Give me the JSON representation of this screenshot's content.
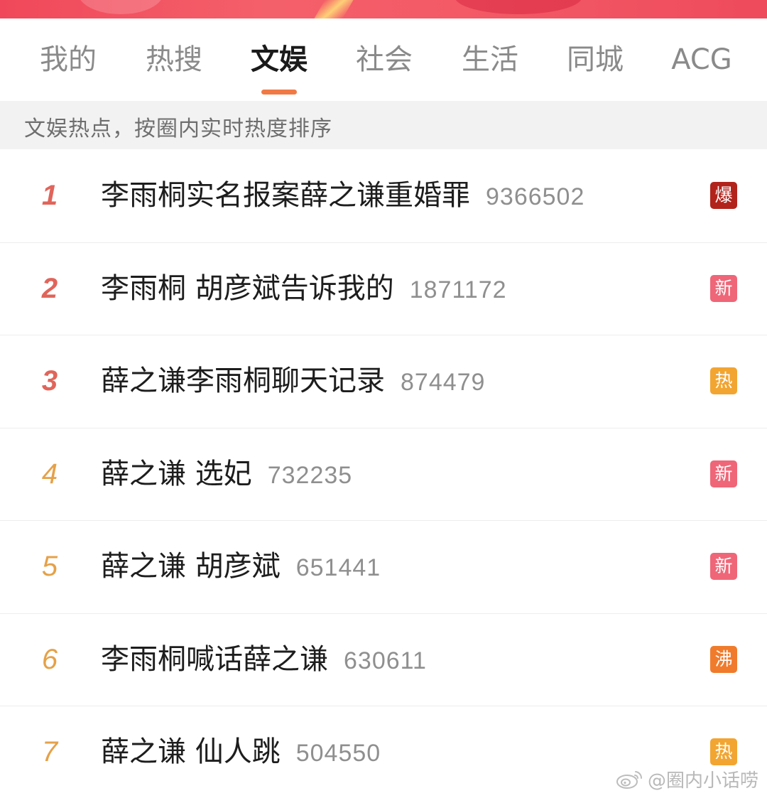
{
  "tabs": [
    {
      "label": "我的",
      "active": false
    },
    {
      "label": "热搜",
      "active": false
    },
    {
      "label": "文娱",
      "active": true
    },
    {
      "label": "社会",
      "active": false
    },
    {
      "label": "生活",
      "active": false
    },
    {
      "label": "同城",
      "active": false
    },
    {
      "label": "ACG",
      "active": false
    }
  ],
  "subheader": {
    "text": "文娱热点，按圈内实时热度排序"
  },
  "items": [
    {
      "rank": "1",
      "title": "李雨桐实名报案薛之谦重婚罪",
      "count": "9366502",
      "badge": "爆",
      "badge_color": "#b2231c"
    },
    {
      "rank": "2",
      "title": "李雨桐 胡彦斌告诉我的",
      "count": "1871172",
      "badge": "新",
      "badge_color": "#ef6678"
    },
    {
      "rank": "3",
      "title": "薛之谦李雨桐聊天记录",
      "count": "874479",
      "badge": "热",
      "badge_color": "#f2a531"
    },
    {
      "rank": "4",
      "title": "薛之谦 选妃",
      "count": "732235",
      "badge": "新",
      "badge_color": "#ef6678"
    },
    {
      "rank": "5",
      "title": "薛之谦 胡彦斌",
      "count": "651441",
      "badge": "新",
      "badge_color": "#ef6678"
    },
    {
      "rank": "6",
      "title": "李雨桐喊话薛之谦",
      "count": "630611",
      "badge": "沸",
      "badge_color": "#f07b2c"
    },
    {
      "rank": "7",
      "title": "薛之谦 仙人跳",
      "count": "504550",
      "badge": "热",
      "badge_color": "#f2a531"
    }
  ],
  "watermark": {
    "icon": "weibo-icon",
    "text": "@圈内小话唠"
  },
  "colors": {
    "rank_top": "#e0655b",
    "rank_normal": "#e5a148",
    "tab_indicator": "#f07a45",
    "banner": "#f0485a"
  }
}
